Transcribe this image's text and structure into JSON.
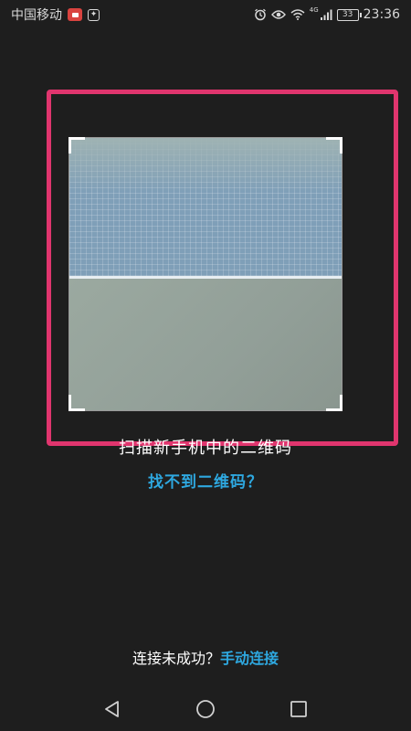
{
  "status_bar": {
    "carrier": "中国移动",
    "network_type": "4G",
    "battery_level": "33",
    "time": "23:36",
    "icons": [
      "video-record-icon",
      "app-notification-icon",
      "alarm-icon",
      "eye-comfort-icon",
      "wifi-icon",
      "signal-icon",
      "battery-icon"
    ]
  },
  "scanner": {
    "hint": "扫描新手机中的二维码",
    "not_found_link": "找不到二维码？"
  },
  "footer": {
    "question": "连接未成功？",
    "manual_link": "手动连接"
  },
  "nav": {
    "icons": [
      "back-icon",
      "home-icon",
      "recents-icon"
    ]
  },
  "colors": {
    "accent": "#2ea8e0",
    "highlight": "#e0356e",
    "background": "#1e1e1e"
  }
}
